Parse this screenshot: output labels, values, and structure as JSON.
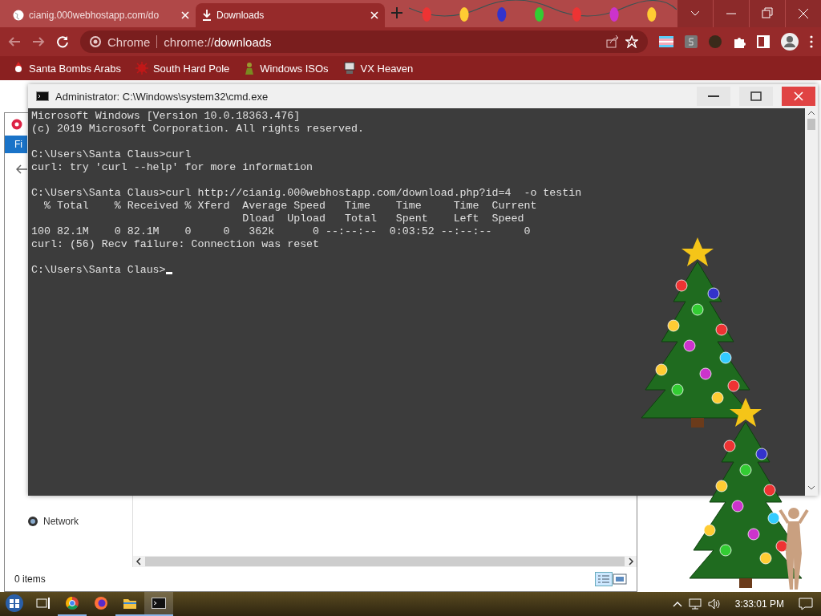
{
  "browser": {
    "tabs": [
      {
        "title": "cianig.000webhostapp.com/do",
        "selected": false
      },
      {
        "title": "Downloads",
        "selected": true
      }
    ],
    "address": {
      "scheme_label": "Chrome",
      "url_prefix": "chrome://",
      "url_page": "downloads"
    },
    "bookmarks": [
      {
        "label": "Santa Bombs Arabs",
        "kind": "santa"
      },
      {
        "label": "South Hard Pole",
        "kind": "splat"
      },
      {
        "label": "Windows ISOs",
        "kind": "person"
      },
      {
        "label": "VX Heaven",
        "kind": "computer"
      }
    ]
  },
  "explorer": {
    "file_tab": "Fi",
    "nav_item": "Network",
    "status": "0 items"
  },
  "cmd": {
    "title": "Administrator: C:\\Windows\\system32\\cmd.exe",
    "blocks": [
      [
        "Microsoft Windows [Version 10.0.18363.476]",
        "(c) 2019 Microsoft Corporation. All rights reserved."
      ],
      [
        "C:\\Users\\Santa Claus>curl",
        "curl: try 'curl --help' for more information"
      ],
      [
        "C:\\Users\\Santa Claus>curl http://cianig.000webhostapp.com/download.php?id=4  -o testin",
        "  % Total    % Received % Xferd  Average Speed   Time    Time     Time  Current",
        "                                 Dload  Upload   Total   Spent    Left  Speed",
        "100 82.1M    0 82.1M    0     0   362k      0 --:--:--  0:03:52 --:--:--     0",
        "curl: (56) Recv failure: Connection was reset"
      ]
    ],
    "prompt": "C:\\Users\\Santa Claus>"
  },
  "taskbar": {
    "apps": [
      {
        "kind": "taskview",
        "running": false,
        "selected": false
      },
      {
        "kind": "chrome",
        "running": true,
        "selected": false
      },
      {
        "kind": "firefox",
        "running": false,
        "selected": false
      },
      {
        "kind": "explorer",
        "running": true,
        "selected": false
      },
      {
        "kind": "cmd",
        "running": true,
        "selected": true
      }
    ],
    "time": "3:33:01 PM"
  }
}
